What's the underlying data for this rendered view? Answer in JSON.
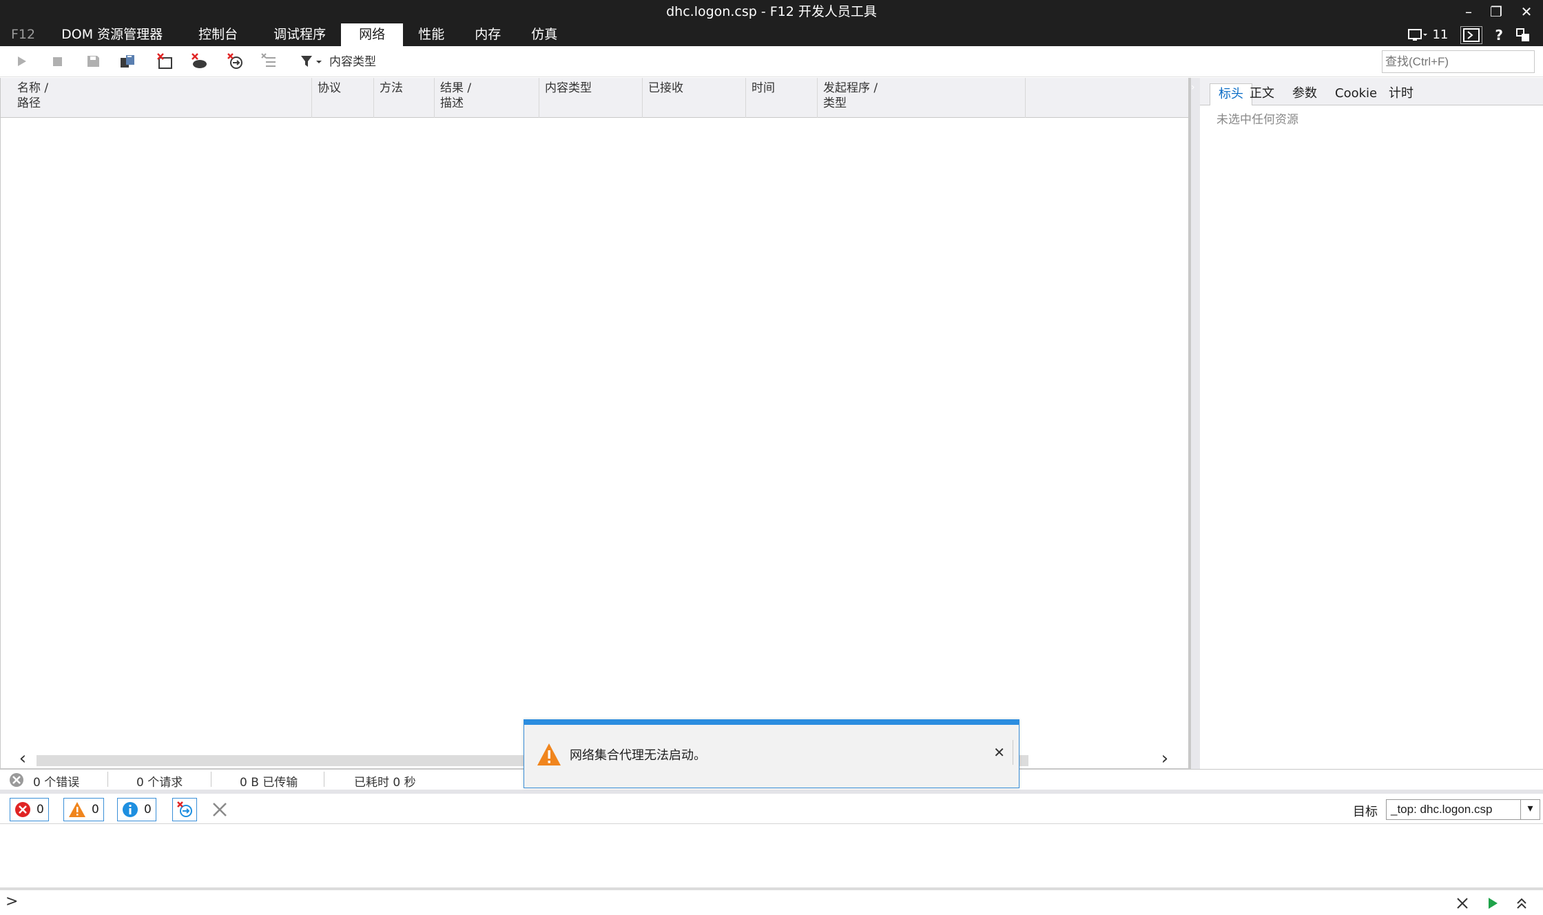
{
  "window": {
    "title": "dhc.logon.csp - F12 开发人员工具",
    "minimize": "–",
    "restore": "❐",
    "close": "✕"
  },
  "tabs": [
    {
      "label": "F12"
    },
    {
      "label": "DOM 资源管理器"
    },
    {
      "label": "控制台"
    },
    {
      "label": "调试程序"
    },
    {
      "label": "网络",
      "active": true
    },
    {
      "label": "性能"
    },
    {
      "label": "内存"
    },
    {
      "label": "仿真"
    }
  ],
  "top_right": {
    "doc_mode": "11",
    "help": "?"
  },
  "toolbar": {
    "content_type_label": "内容类型",
    "search_placeholder": "查找(Ctrl+F)"
  },
  "columns": [
    {
      "line1": "名称 /",
      "line2": "路径"
    },
    {
      "line1": "",
      "line2": "协议"
    },
    {
      "line1": "",
      "line2": "方法"
    },
    {
      "line1": "结果 /",
      "line2": "描述"
    },
    {
      "line1": "",
      "line2": "内容类型"
    },
    {
      "line1": "",
      "line2": "已接收"
    },
    {
      "line1": "",
      "line2": "时间"
    },
    {
      "line1": "发起程序 /",
      "line2": "类型"
    }
  ],
  "details": {
    "tabs": [
      "标头",
      "正文",
      "参数",
      "Cookie",
      "计时"
    ],
    "active_tab": "标头",
    "empty_text": "未选中任何资源"
  },
  "status": {
    "errors": "0 个错误",
    "requests": "0 个请求",
    "transferred": "0 B 已传输",
    "elapsed": "已耗时 0 秒"
  },
  "console": {
    "error_count": "0",
    "warning_count": "0",
    "info_count": "0",
    "target_label": "目标",
    "target_value": "_top: dhc.logon.csp",
    "prompt": ">"
  },
  "notification": {
    "message": "网络集合代理无法启动。"
  },
  "colors": {
    "titlebar": "#1f1f1f",
    "accent": "#2b8de0",
    "warning": "#f0851d",
    "error": "#e02424",
    "info": "#1e8fe0"
  }
}
